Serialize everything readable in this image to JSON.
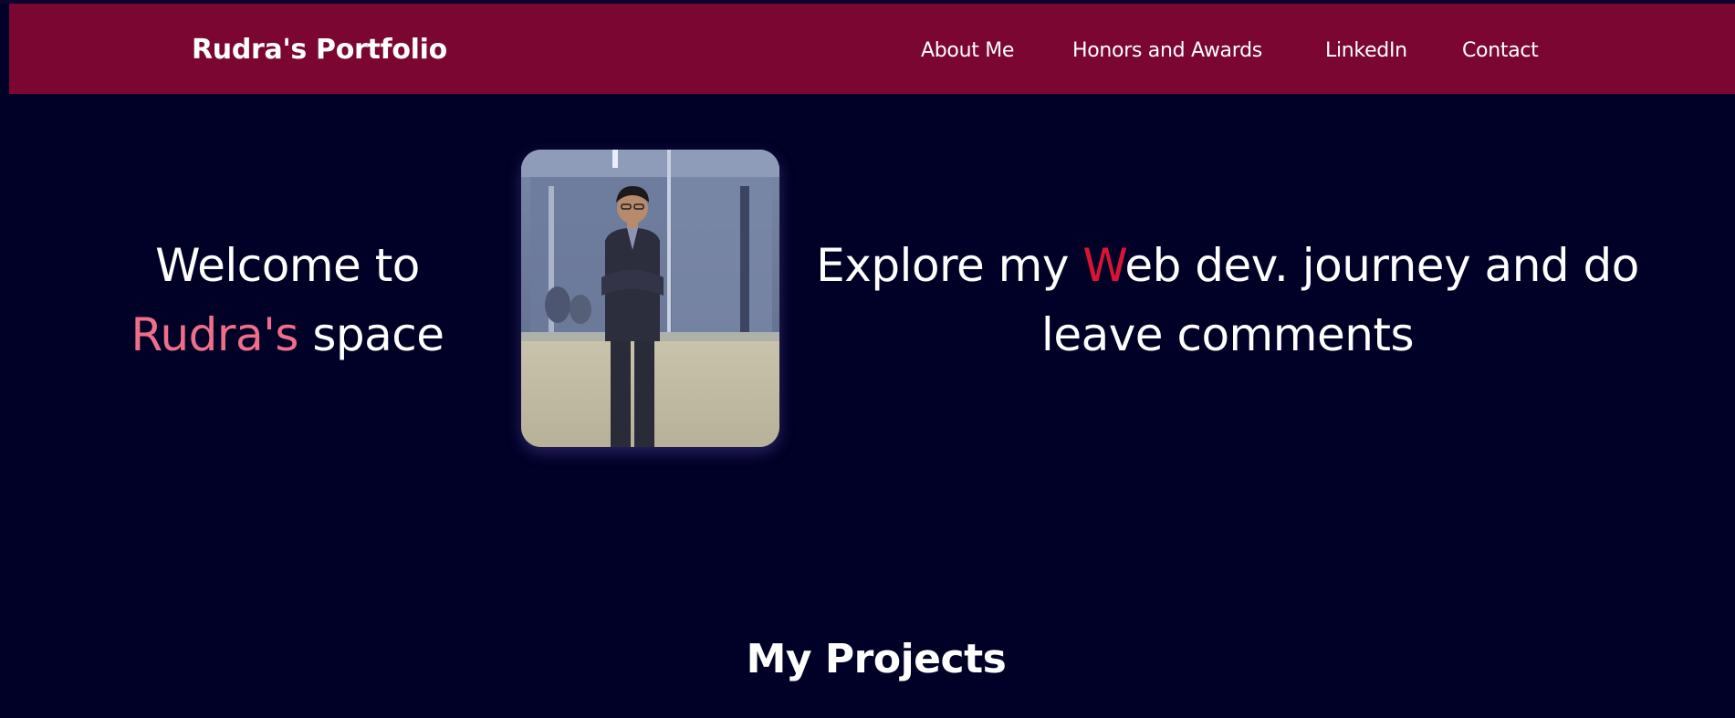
{
  "navbar": {
    "brand": "Rudra's Portfolio",
    "links": [
      {
        "label": "About Me"
      },
      {
        "label": "Honors and Awards"
      },
      {
        "label": "LinkedIn"
      },
      {
        "label": "Contact"
      }
    ],
    "background_color": "#7a0631"
  },
  "hero": {
    "left": {
      "line1": "Welcome to",
      "name": "Rudra's",
      "rest": " space"
    },
    "photo": {
      "description_icon": "profile-photo"
    },
    "right": {
      "prefix": "Explore my ",
      "accent_letter": "W",
      "rest": "eb dev. journey and do leave comments"
    }
  },
  "projects": {
    "title": "My Projects"
  },
  "colors": {
    "page_background": "#010127",
    "accent_pink": "#ef6f8a",
    "accent_red": "#dc1433",
    "text": "#ffffff"
  }
}
